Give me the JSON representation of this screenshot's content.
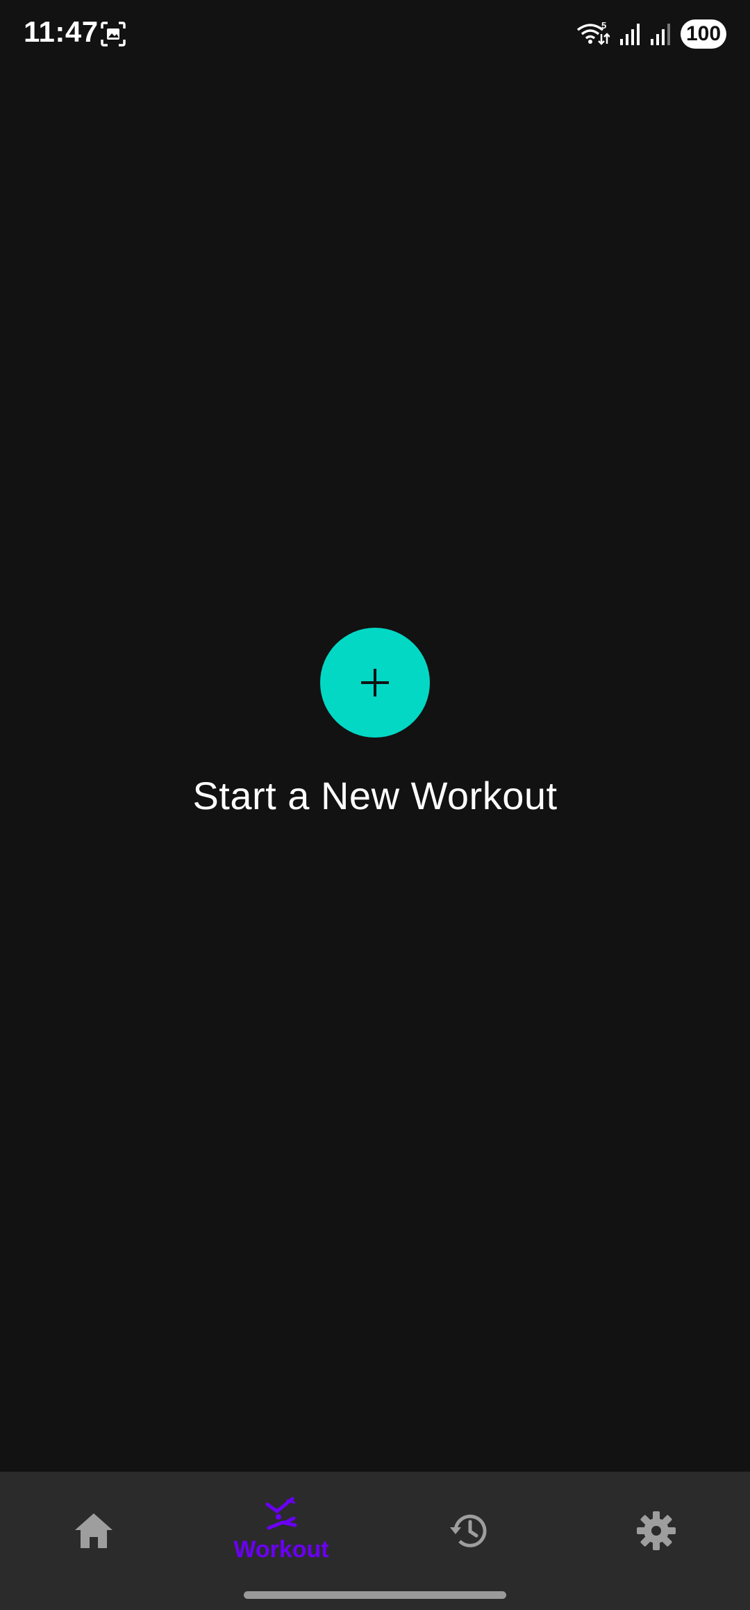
{
  "status_bar": {
    "time": "11:47",
    "battery": "100",
    "wifi_badge": "5",
    "icons": [
      "screenshot-icon",
      "wifi-icon",
      "signal-icon",
      "signal-icon"
    ]
  },
  "main": {
    "fab_icon": "plus-icon",
    "start_label": "Start a New Workout"
  },
  "bottom_nav": {
    "items": [
      {
        "icon": "home-icon",
        "label": "",
        "active": false
      },
      {
        "icon": "workout-icon",
        "label": "Workout",
        "active": true
      },
      {
        "icon": "history-icon",
        "label": "",
        "active": false
      },
      {
        "icon": "gear-icon",
        "label": "",
        "active": false
      }
    ]
  },
  "colors": {
    "background": "#121212",
    "accent": "#03D8C5",
    "nav_background": "#2b2b2b",
    "active_nav": "#6a00f4",
    "inactive_nav": "#9e9e9e"
  }
}
